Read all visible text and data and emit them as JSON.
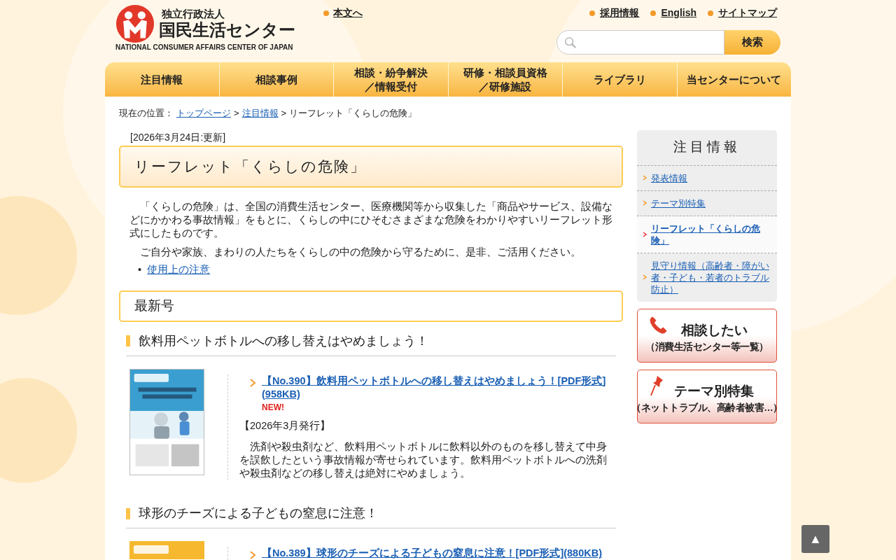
{
  "header": {
    "logo_org_type": "独立行政法人",
    "logo_name": "国民生活センター",
    "logo_english": "NATIONAL CONSUMER AFFAIRS CENTER OF JAPAN",
    "skip_link": "本文へ",
    "utility_links": [
      "採用情報",
      "English",
      "サイトマップ"
    ],
    "search": {
      "button": "検索"
    }
  },
  "nav": [
    {
      "lines": [
        "注目情報"
      ]
    },
    {
      "lines": [
        "相談事例"
      ]
    },
    {
      "lines": [
        "相談・紛争解決",
        "／情報受付"
      ]
    },
    {
      "lines": [
        "研修・相談員資格",
        "／研修施設"
      ]
    },
    {
      "lines": [
        "ライブラリ"
      ]
    },
    {
      "lines": [
        "当センターについて"
      ]
    }
  ],
  "breadcrumb": {
    "label": "現在の位置：",
    "links": [
      "トップページ",
      "注目情報"
    ],
    "current": "リーフレット「くらしの危険」",
    "separator": ">"
  },
  "updated": "[2026年3月24日:更新]",
  "title": "リーフレット「くらしの危険」",
  "intro": [
    "「くらしの危険」は、全国の消費生活センター、医療機関等から収集した「商品やサービス、設備などにかかわる事故情報」をもとに、くらしの中にひそむさまざまな危険をわかりやすいリーフレット形式にしたものです。",
    "ご自分や家族、まわりの人たちをくらしの中の危険から守るために、是非、ご活用ください。"
  ],
  "intro_links": [
    {
      "bullet": "•",
      "label": "使用上の注意"
    }
  ],
  "section_title": "最新号",
  "issues": [
    {
      "heading": "飲料用ペットボトルへの移し替えはやめましょう！",
      "link": "【No.390】飲料用ペットボトルへの移し替えはやめましょう！[PDF形式](958KB)",
      "new_badge": "NEW!",
      "date": "【2026年3月発行】",
      "description": "洗剤や殺虫剤など、飲料用ペットボトルに飲料以外のものを移し替えて中身を誤飲したという事故情報が寄せられています。飲料用ペットボトルへの洗剤や殺虫剤などの移し替えは絶対にやめましょう。"
    },
    {
      "heading": "球形のチーズによる子どもの窒息に注意！",
      "link": "【No.389】球形のチーズによる子どもの窒息に注意！[PDF形式](880KB)"
    }
  ],
  "sidebar": {
    "title": "注目情報",
    "items": [
      {
        "label": "発表情報",
        "selected": false
      },
      {
        "label": "テーマ別特集",
        "selected": false
      },
      {
        "label": "リーフレット「くらしの危険」",
        "selected": true
      },
      {
        "label": "見守り情報（高齢者・障がい者・子ども・若者のトラブル防止）",
        "selected": false
      }
    ]
  },
  "banners": [
    {
      "kind": "phone",
      "title": "相談したい",
      "subtitle": "（消費生活センター等一覧）"
    },
    {
      "kind": "pin",
      "title": "テーマ別特集",
      "subtitle": "（ネットトラブル、高齢者被害…）"
    }
  ],
  "page_top": "▲"
}
